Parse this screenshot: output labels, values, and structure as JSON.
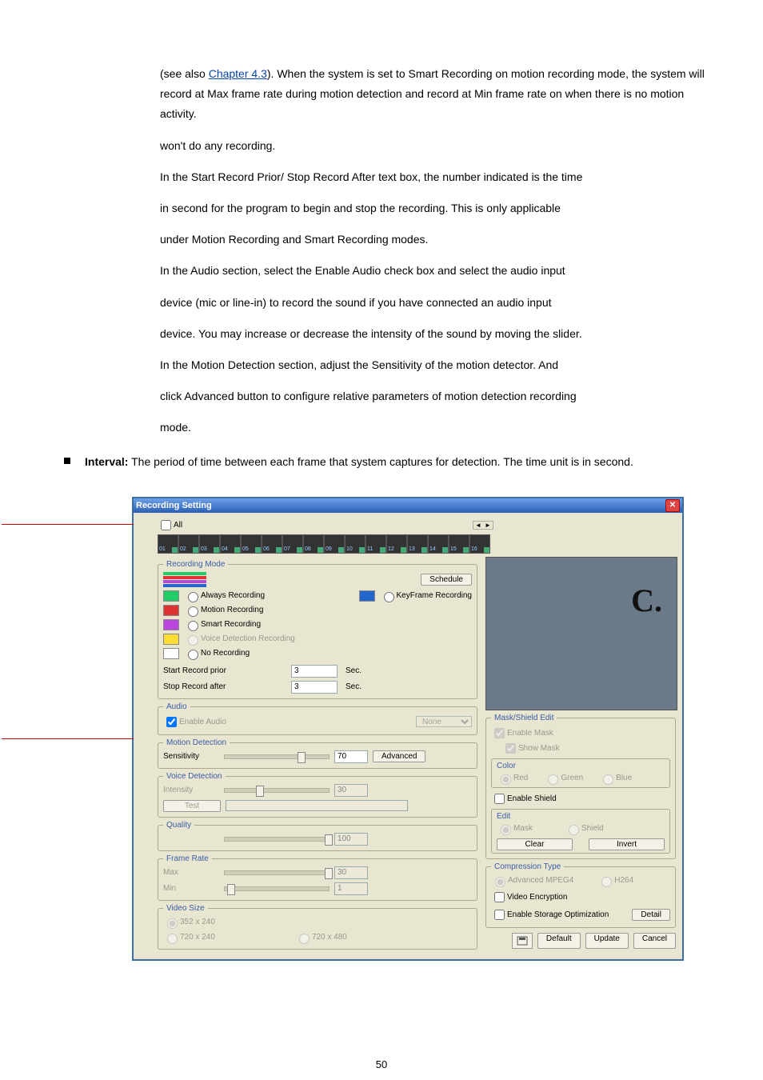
{
  "intro": {
    "prefix": "(see also ",
    "link_text": "Chapter 4.3",
    "after_link": "). When the system is set to Smart Recording on motion recording mode, the system will record at Max frame rate during motion detection and record at Min frame rate on when there is no motion activity.",
    "line2": "won't do any recording."
  },
  "body_lines": [
    "In the Start Record Prior/ Stop Record After text box, the number indicated is the time",
    "in second for the program to begin and stop the recording. This is only applicable",
    "under Motion Recording and Smart Recording modes.",
    "In the Audio section, select the Enable Audio check box and select the audio input",
    "device (mic or line-in) to record the sound if you have connected an audio input",
    "device. You may increase or decrease the intensity of the sound by moving the slider.",
    "In the Motion Detection section, adjust the Sensitivity of the motion detector. And",
    "click Advanced button to configure relative parameters of motion detection recording",
    "mode."
  ],
  "bullet": {
    "bold": "Interval:",
    "rest": " The period of time between each frame that system captures for detection. The time unit is in second."
  },
  "win_title": "Recording Setting",
  "all_label": "All",
  "cam_nums": [
    "01",
    "02",
    "03",
    "04",
    "05",
    "06",
    "07",
    "08",
    "09",
    "10",
    "11",
    "12",
    "13",
    "14",
    "15",
    "16"
  ],
  "rec_mode_title": "Recording Mode",
  "schedule_btn": "Schedule",
  "modes": {
    "always": "Always Recording",
    "keyframe": "KeyFrame Recording",
    "motion": "Motion Recording",
    "smart": "Smart Recording",
    "voice": "Voice Detection Recording",
    "none": "No Recording"
  },
  "start_prior_lbl": "Start Record prior",
  "stop_after_lbl": "Stop Record after",
  "start_prior_val": "3",
  "stop_after_val": "3",
  "sec": "Sec.",
  "audio_title": "Audio",
  "enable_audio": "Enable Audio",
  "audio_device": "None",
  "motion_title": "Motion Detection",
  "sensitivity_lbl": "Sensitivity",
  "sensitivity_val": "70",
  "advanced_btn": "Advanced",
  "voice_title": "Voice Detection",
  "intensity_lbl": "Intensity",
  "intensity_val": "30",
  "test_btn": "Test",
  "quality_title": "Quality",
  "quality_val": "100",
  "frame_title": "Frame Rate",
  "max_lbl": "Max",
  "max_val": "30",
  "min_lbl": "Min",
  "min_val": "1",
  "vsize_title": "Video Size",
  "vsize_opts": [
    "352 x 240",
    "720 x 240",
    "720 x 480"
  ],
  "mask_title": "Mask/Shield Edit",
  "enable_mask": "Enable Mask",
  "show_mask": "Show Mask",
  "color_lbl": "Color",
  "colors": {
    "red": "Red",
    "green": "Green",
    "blue": "Blue"
  },
  "enable_shield": "Enable Shield",
  "edit_lbl": "Edit",
  "edit_opts": {
    "mask": "Mask",
    "shield": "Shield"
  },
  "clear_btn": "Clear",
  "invert_btn": "Invert",
  "comp_title": "Compression Type",
  "comp_opts": {
    "mpeg4": "Advanced MPEG4",
    "h264": "H264"
  },
  "video_enc": "Video Encryption",
  "storage_opt": "Enable Storage Optimization",
  "detail_btn": "Detail",
  "default_btn": "Default",
  "update_btn": "Update",
  "cancel_btn": "Cancel",
  "preview_letter": "C.",
  "page_number": "50"
}
